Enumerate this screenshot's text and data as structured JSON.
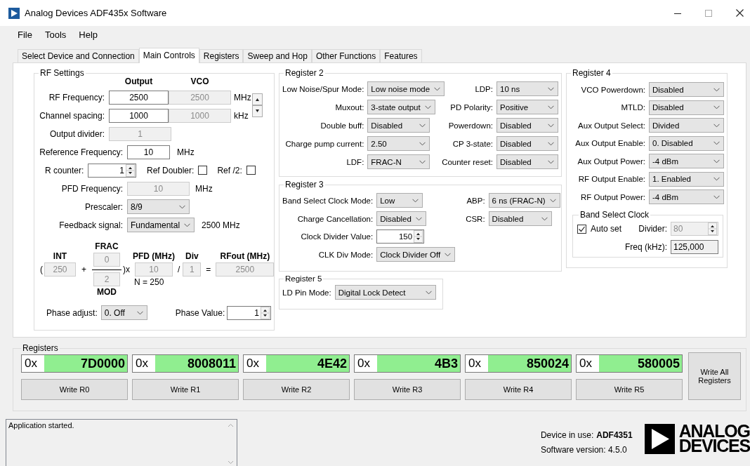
{
  "window": {
    "title": "Analog Devices ADF435x Software"
  },
  "menu": [
    {
      "label": "File"
    },
    {
      "label": "Tools"
    },
    {
      "label": "Help"
    }
  ],
  "tabs": [
    {
      "label": "Select Device and Connection",
      "selected": false
    },
    {
      "label": "Main Controls",
      "selected": true
    },
    {
      "label": "Registers",
      "selected": false
    },
    {
      "label": "Sweep and Hop",
      "selected": false
    },
    {
      "label": "Other Functions",
      "selected": false
    },
    {
      "label": "Features",
      "selected": false
    }
  ],
  "rf_settings": {
    "title": "RF Settings",
    "col_headers": [
      "Output",
      "VCO"
    ],
    "rows": [
      {
        "label": "RF Frequency:",
        "output": {
          "kind": "text",
          "value": "2500",
          "disabled": false
        },
        "vco": {
          "kind": "text",
          "value": "2500",
          "disabled": true
        },
        "unit": "MHz"
      },
      {
        "label": "Channel spacing:",
        "output": {
          "kind": "text",
          "value": "1000",
          "disabled": false
        },
        "vco": {
          "kind": "text",
          "value": "1000",
          "disabled": true
        },
        "unit": "kHz"
      }
    ],
    "output_divider": {
      "label": "Output divider:",
      "field": {
        "kind": "text",
        "value": "1",
        "disabled": true
      }
    },
    "reference_frequency": {
      "label": "Reference Frequency:",
      "field": {
        "kind": "text",
        "value": "10",
        "disabled": false
      },
      "unit": "MHz"
    },
    "r_counter": {
      "label": "R counter:",
      "field": {
        "kind": "spin",
        "value": "1",
        "disabled": false
      }
    },
    "ref_doubler": {
      "label": "Ref Doubler:",
      "checked": false
    },
    "ref_div2": {
      "label": "Ref /2:",
      "checked": false
    },
    "pfd_frequency": {
      "label": "PFD Frequency:",
      "field": {
        "kind": "text",
        "value": "10",
        "disabled": true
      },
      "unit": "MHz"
    },
    "prescaler": {
      "label": "Prescaler:",
      "field": {
        "kind": "dropdown",
        "value": "8/9"
      }
    },
    "feedback_signal": {
      "label": "Feedback signal:",
      "field": {
        "kind": "dropdown",
        "value": "Fundamental"
      },
      "reading": "2500 MHz"
    },
    "formula": {
      "open": "(",
      "int_label": "INT",
      "int": {
        "kind": "text",
        "value": "250",
        "disabled": true
      },
      "plus": "+",
      "frac_label": "FRAC",
      "frac": {
        "kind": "text",
        "value": "0",
        "disabled": true
      },
      "mod": {
        "kind": "text",
        "value": "2",
        "disabled": true
      },
      "mod_label": "MOD",
      "close": ")x",
      "pfd_label": "PFD (MHz)",
      "pfd": {
        "kind": "text",
        "value": "10",
        "disabled": true
      },
      "n": "N = 250",
      "slash": "/",
      "div_label": "Div",
      "div": {
        "kind": "text",
        "value": "1",
        "disabled": true
      },
      "equals": "=",
      "rfout_label": "RFout (MHz)",
      "rfout": {
        "kind": "text",
        "value": "2500",
        "disabled": true
      }
    },
    "phase_adjust": {
      "label": "Phase adjust:",
      "field": {
        "kind": "dropdown",
        "value": "0. Off"
      }
    },
    "phase_value": {
      "label": "Phase Value:",
      "field": {
        "kind": "spin",
        "value": "1",
        "disabled": false
      }
    }
  },
  "register_2": {
    "title": "Register 2",
    "rows": [
      [
        {
          "label": "Low Noise/Spur Mode:",
          "kind": "dropdown",
          "value": "Low noise mode"
        },
        {
          "label": "LDP:",
          "kind": "dropdown",
          "value": "10 ns"
        }
      ],
      [
        {
          "label": "Muxout:",
          "kind": "dropdown",
          "value": "3-state output"
        },
        {
          "label": "PD Polarity:",
          "kind": "dropdown",
          "value": "Positive"
        }
      ],
      [
        {
          "label": "Double buff:",
          "kind": "dropdown",
          "value": "Disabled"
        },
        {
          "label": "Powerdown:",
          "kind": "dropdown",
          "value": "Disabled"
        }
      ],
      [
        {
          "label": "Charge pump current:",
          "kind": "dropdown",
          "value": "2.50"
        },
        {
          "label": "CP 3-state:",
          "kind": "dropdown",
          "value": "Disabled"
        }
      ],
      [
        {
          "label": "LDF:",
          "kind": "dropdown",
          "value": "FRAC-N"
        },
        {
          "label": "Counter reset:",
          "kind": "dropdown",
          "value": "Disabled"
        }
      ]
    ]
  },
  "register_3": {
    "title": "Register 3",
    "rows": [
      [
        {
          "label": "Band Select Clock Mode:",
          "kind": "dropdown",
          "value": "Low"
        },
        {
          "label": "ABP:",
          "kind": "dropdown",
          "value": "6 ns (FRAC-N)"
        }
      ],
      [
        {
          "label": "Charge Cancellation:",
          "kind": "dropdown",
          "value": "Disabled"
        },
        {
          "label": "CSR:",
          "kind": "dropdown",
          "value": "Disabled"
        }
      ],
      [
        {
          "label": "Clock Divider Value:",
          "kind": "spin",
          "value": "150",
          "disabled": false
        }
      ],
      [
        {
          "label": "CLK Div Mode:",
          "kind": "dropdown",
          "value": "Clock Divider Off"
        }
      ]
    ]
  },
  "register_5": {
    "title": "Register 5",
    "fields": [
      {
        "label": "LD Pin Mode:",
        "kind": "dropdown",
        "value": "Digital Lock Detect"
      }
    ]
  },
  "register_4": {
    "title": "Register 4",
    "fields": [
      {
        "label": "VCO Powerdown:",
        "kind": "dropdown",
        "value": "Disabled"
      },
      {
        "label": "MTLD:",
        "kind": "dropdown",
        "value": "Disabled"
      },
      {
        "label": "Aux Output Select:",
        "kind": "dropdown",
        "value": "Divided"
      },
      {
        "label": "Aux Output Enable:",
        "kind": "dropdown",
        "value": "0. Disabled"
      },
      {
        "label": "Aux Output Power:",
        "kind": "dropdown",
        "value": "-4 dBm"
      },
      {
        "label": "RF Output Enable:",
        "kind": "dropdown",
        "value": "1. Enabled"
      },
      {
        "label": "RF Output Power:",
        "kind": "dropdown",
        "value": "-4 dBm"
      }
    ],
    "band_select_clock": {
      "title": "Band Select Clock",
      "auto_set": {
        "label": "Auto set",
        "checked": true
      },
      "divider": {
        "label": "Divider:",
        "kind": "spin",
        "value": "80",
        "disabled": true
      },
      "freq": {
        "label": "Freq (kHz):",
        "kind": "readonly",
        "value": "125,000"
      }
    }
  },
  "registers": {
    "title": "Registers",
    "items": [
      {
        "prefix": "0x",
        "value": "7D0000",
        "button": "Write R0"
      },
      {
        "prefix": "0x",
        "value": "8008011",
        "button": "Write R1"
      },
      {
        "prefix": "0x",
        "value": "4E42",
        "button": "Write R2"
      },
      {
        "prefix": "0x",
        "value": "4B3",
        "button": "Write R3"
      },
      {
        "prefix": "0x",
        "value": "850024",
        "button": "Write R4"
      },
      {
        "prefix": "0x",
        "value": "580005",
        "button": "Write R5"
      }
    ],
    "write_all": "Write All Registers"
  },
  "log": {
    "lines": [
      "Application started."
    ]
  },
  "device": {
    "label": "Device in use:",
    "value": "ADF4351"
  },
  "software_version": "Software version: 4.5.0",
  "logo": {
    "lines": [
      "ANALOG",
      "DEVICES"
    ]
  }
}
